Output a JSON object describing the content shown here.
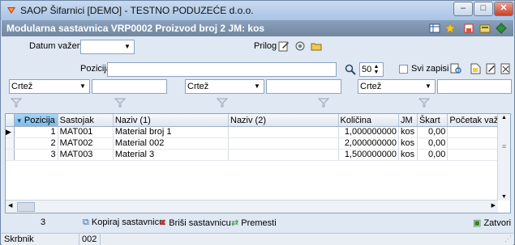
{
  "window": {
    "title": "SAOP Šifarnici [DEMO] - TESTNO PODUZEĆE d.o.o.",
    "minimize": "–",
    "maximize": "□",
    "close": "✕"
  },
  "header": {
    "title": "Modularna sastavnica VRP0002 Proizvod broj 2   JM: kos"
  },
  "top_form": {
    "datum_label": "Datum važenja",
    "datum_value": "",
    "prilog_label": "Prilog"
  },
  "search": {
    "pozicija_label": "Pozicija",
    "pozicija_value": "",
    "count_value": "50",
    "svi_zapisi_label": "Svi zapisi"
  },
  "filters": [
    {
      "field": "Crtež",
      "value": ""
    },
    {
      "field": "Crtež",
      "value": ""
    },
    {
      "field": "Crtež",
      "value": ""
    }
  ],
  "grid": {
    "columns": [
      "Pozicija",
      "Sastojak",
      "Naziv (1)",
      "Naziv (2)",
      "Količina",
      "JM",
      "Škart",
      "Početak važnc"
    ],
    "rows": [
      {
        "pozicija": "1",
        "sastojak": "MAT001",
        "naziv1": "Material broj 1",
        "naziv2": "",
        "kolicina": "1,000000000",
        "jm": "kos",
        "skart": "0,00",
        "pocetak": ""
      },
      {
        "pozicija": "2",
        "sastojak": "MAT002",
        "naziv1": "Material 002",
        "naziv2": "",
        "kolicina": "2,000000000",
        "jm": "kos",
        "skart": "0,00",
        "pocetak": ""
      },
      {
        "pozicija": "3",
        "sastojak": "MAT003",
        "naziv1": "Material 3",
        "naziv2": "",
        "kolicina": "1,500000000",
        "jm": "kos",
        "skart": "0,00",
        "pocetak": ""
      }
    ]
  },
  "bottom": {
    "count": "3",
    "kopiraj": "Kopiraj sastavnicu",
    "brisi": "Briši sastavnicu",
    "premesti": "Premesti",
    "zatvori": "Zatvori"
  },
  "status": {
    "label": "Skrbnik",
    "value": "002"
  },
  "colors": {
    "header_bg": "#7a90ab",
    "sort_header": "#8ec5ef"
  }
}
